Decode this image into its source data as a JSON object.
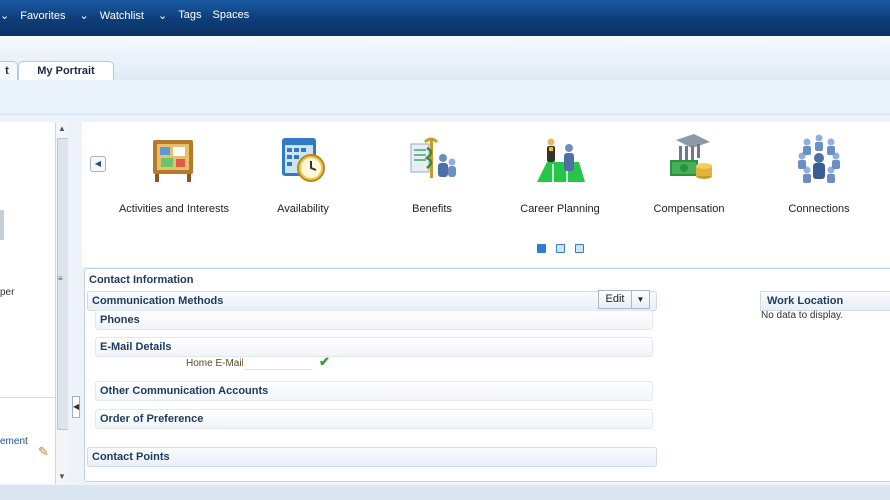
{
  "top_nav": [
    "Favorites",
    "Watchlist",
    "Tags",
    "Spaces"
  ],
  "tabs": {
    "partial_left": "t",
    "active": "My Portrait"
  },
  "left_panel": {
    "partial_text_1": "per",
    "partial_link": "ement"
  },
  "carousel": {
    "items": [
      {
        "label": "Activities and Interests",
        "icon": "bulletin-board-icon"
      },
      {
        "label": "Availability",
        "icon": "calendar-clock-icon"
      },
      {
        "label": "Benefits",
        "icon": "caduceus-people-icon"
      },
      {
        "label": "Career Planning",
        "icon": "career-ladder-icon"
      },
      {
        "label": "Compensation",
        "icon": "money-stack-icon"
      },
      {
        "label": "Connections",
        "icon": "people-group-icon"
      }
    ],
    "page_count": 3,
    "active_page": 1
  },
  "contact": {
    "title": "Contact Information",
    "communication_methods": "Communication Methods",
    "edit_label": "Edit",
    "phones": "Phones",
    "email_details": "E-Mail Details",
    "home_email_label": "Home E-Mail",
    "other_accounts": "Other Communication Accounts",
    "order_of_preference": "Order of Preference",
    "contact_points": "Contact Points"
  },
  "work_location": {
    "title": "Work Location",
    "empty": "No data to display."
  },
  "colors": {
    "header": "#0d3d78",
    "accent": "#2d7fd6",
    "check": "#2fa32f"
  }
}
